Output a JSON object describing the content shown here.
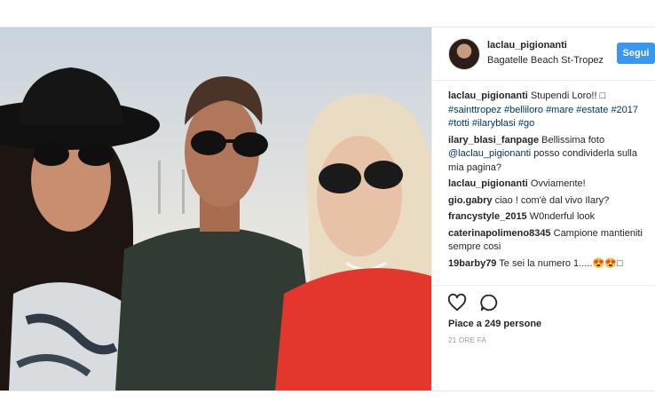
{
  "post": {
    "username": "laclau_pigionanti",
    "location": "Bagatelle Beach St-Tropez",
    "follow_label": "Segui",
    "caption": {
      "user": "laclau_pigionanti",
      "text": "Stupendi Loro!! □",
      "hashtags": "#sainttropez #belliloro #mare #estate #2017 #totti #ilaryblasi #go"
    },
    "comments": [
      {
        "user": "ilary_blasi_fanpage",
        "text": "Bellissima foto",
        "mention": "@laclau_pigionanti",
        "text2": "posso condividerla sulla mia pagina?"
      },
      {
        "user": "laclau_pigionanti",
        "text": "Ovviamente!"
      },
      {
        "user": "gio.gabry",
        "text": "ciao ! com'è dal vivo Ilary?"
      },
      {
        "user": "francystyle_2015",
        "text": "W0nderful look"
      },
      {
        "user": "caterinapolimeno8345",
        "text": "Campione mantieniti sempre cosi"
      },
      {
        "user": "19barby79",
        "text": "Te sei la numero 1.....😍😍□"
      }
    ],
    "likes": "Piace a 249 persone",
    "time": "21 ORE FA",
    "icons": [
      "heart-icon",
      "comment-icon"
    ],
    "accent_color": "#3897f0"
  }
}
